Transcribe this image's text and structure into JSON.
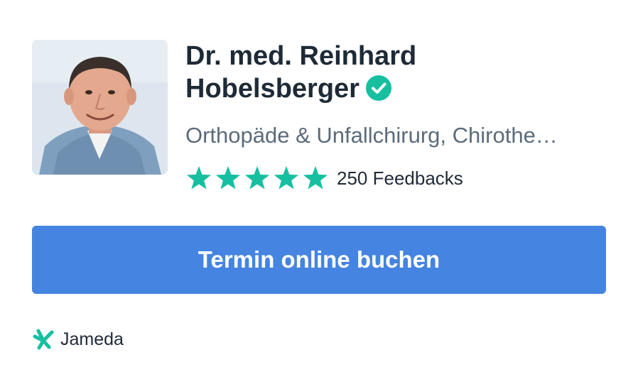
{
  "profile": {
    "name_line1": "Dr. med. Reinhard",
    "name_line2": "Hobelsberger",
    "specialty": "Orthopäde & Unfallchirurg, Chirothe…",
    "rating": 5,
    "max_rating": 5,
    "feedback_label": "250 Feedbacks",
    "photo_icon": "doctor-portrait",
    "verified_icon": "verified-check-icon"
  },
  "actions": {
    "book_label": "Termin online buchen"
  },
  "brand": {
    "name": "Jameda",
    "icon": "jameda-logo-icon"
  },
  "colors": {
    "accent_green": "#16bfa0",
    "button_blue": "#4584e0",
    "text_dark": "#1f2a37",
    "text_muted": "#5b6b7b"
  }
}
